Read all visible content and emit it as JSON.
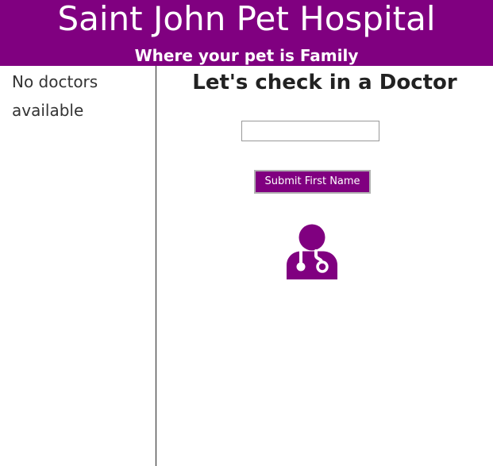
{
  "header": {
    "title": "Saint John Pet Hospital",
    "subtitle": "Where your pet is Family",
    "background_color": "#800080"
  },
  "sidebar": {
    "empty_message": "No doctors available"
  },
  "main": {
    "heading": "Let's check in a Doctor",
    "first_name_input": {
      "value": "",
      "placeholder": ""
    },
    "submit_button_label": "Submit First Name",
    "icon": "user-doctor-icon"
  }
}
